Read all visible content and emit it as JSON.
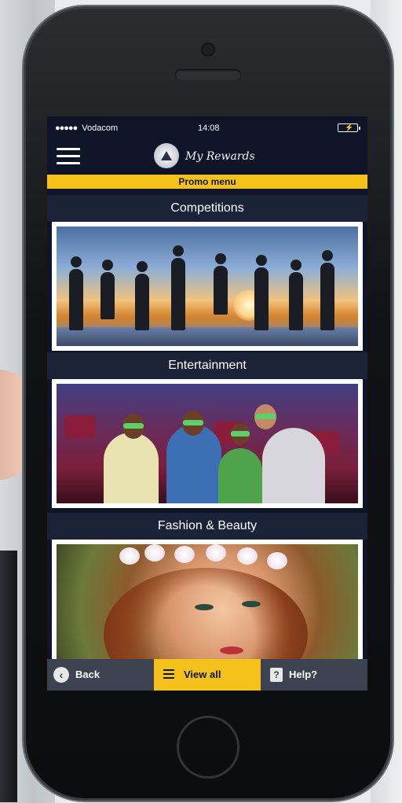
{
  "status_bar": {
    "signal_dots": "●●●●●",
    "carrier": "Vodacom",
    "time": "14:08",
    "battery_icon": "battery-charging-icon"
  },
  "app_bar": {
    "menu_icon": "hamburger-menu-icon",
    "app_name": "My Rewards"
  },
  "promo_bar": {
    "label": "Promo menu"
  },
  "sections": [
    {
      "title": "Competitions"
    },
    {
      "title": "Entertainment"
    },
    {
      "title": "Fashion & Beauty"
    }
  ],
  "bottom_nav": {
    "back_label": "Back",
    "view_all_label": "View all",
    "help_label": "Help?"
  },
  "colors": {
    "accent_yellow": "#f4c21a",
    "navy": "#0f1529",
    "section_header": "#1b2338",
    "bottom_bar": "#3d4250"
  }
}
